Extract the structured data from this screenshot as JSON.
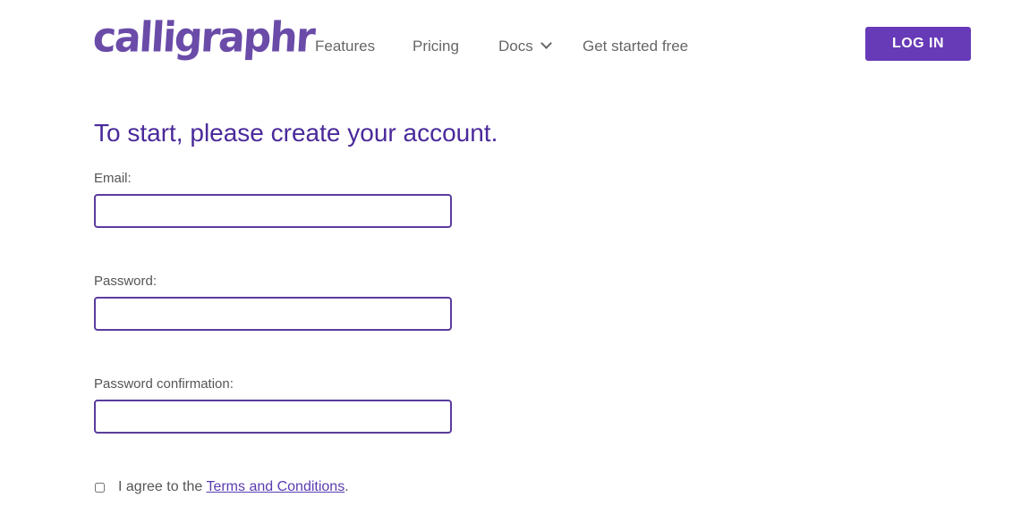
{
  "header": {
    "logo": "calligraphr",
    "nav": [
      {
        "label": "Features"
      },
      {
        "label": "Pricing"
      },
      {
        "label": "Docs"
      },
      {
        "label": "Get started free"
      }
    ],
    "login_label": "LOG IN"
  },
  "form": {
    "title": "To start, please create your account.",
    "email_label": "Email:",
    "email_value": "",
    "password_label": "Password:",
    "password_value": "",
    "confirm_label": "Password confirmation:",
    "confirm_value": "",
    "agree_prefix": "I agree to the ",
    "terms_link": "Terms and Conditions",
    "agree_suffix": ".",
    "agree_checked": false
  },
  "colors": {
    "accent": "#673ab7",
    "heading": "#4a2a9a"
  }
}
